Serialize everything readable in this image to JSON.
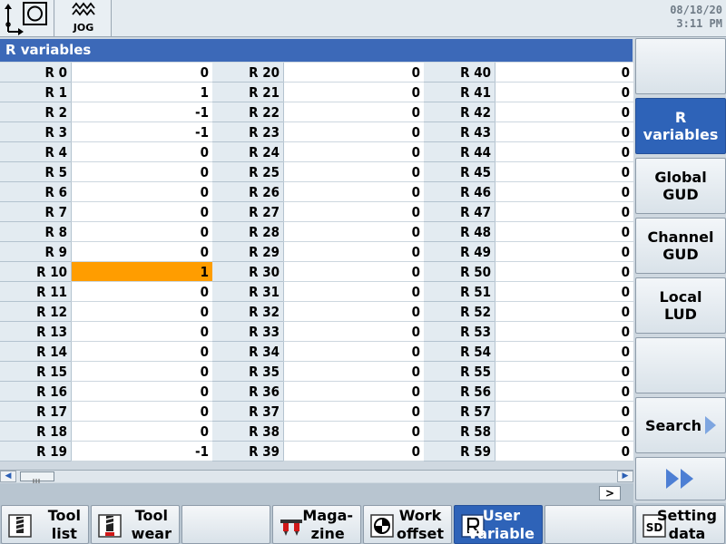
{
  "header": {
    "mode_label": "JOG",
    "date": "08/18/20",
    "time": "3:11 PM",
    "icons": [
      "machine-area-icon",
      "jog-mode-icon"
    ]
  },
  "window": {
    "title": "R variables"
  },
  "table": {
    "columns": [
      [
        {
          "name": "R 0",
          "value": "0"
        },
        {
          "name": "R 1",
          "value": "1"
        },
        {
          "name": "R 2",
          "value": "-1"
        },
        {
          "name": "R 3",
          "value": "-1"
        },
        {
          "name": "R 4",
          "value": "0"
        },
        {
          "name": "R 5",
          "value": "0"
        },
        {
          "name": "R 6",
          "value": "0"
        },
        {
          "name": "R 7",
          "value": "0"
        },
        {
          "name": "R 8",
          "value": "0"
        },
        {
          "name": "R 9",
          "value": "0"
        },
        {
          "name": "R 10",
          "value": "1"
        },
        {
          "name": "R 11",
          "value": "0"
        },
        {
          "name": "R 12",
          "value": "0"
        },
        {
          "name": "R 13",
          "value": "0"
        },
        {
          "name": "R 14",
          "value": "0"
        },
        {
          "name": "R 15",
          "value": "0"
        },
        {
          "name": "R 16",
          "value": "0"
        },
        {
          "name": "R 17",
          "value": "0"
        },
        {
          "name": "R 18",
          "value": "0"
        },
        {
          "name": "R 19",
          "value": "-1"
        }
      ],
      [
        {
          "name": "R 20",
          "value": "0"
        },
        {
          "name": "R 21",
          "value": "0"
        },
        {
          "name": "R 22",
          "value": "0"
        },
        {
          "name": "R 23",
          "value": "0"
        },
        {
          "name": "R 24",
          "value": "0"
        },
        {
          "name": "R 25",
          "value": "0"
        },
        {
          "name": "R 26",
          "value": "0"
        },
        {
          "name": "R 27",
          "value": "0"
        },
        {
          "name": "R 28",
          "value": "0"
        },
        {
          "name": "R 29",
          "value": "0"
        },
        {
          "name": "R 30",
          "value": "0"
        },
        {
          "name": "R 31",
          "value": "0"
        },
        {
          "name": "R 32",
          "value": "0"
        },
        {
          "name": "R 33",
          "value": "0"
        },
        {
          "name": "R 34",
          "value": "0"
        },
        {
          "name": "R 35",
          "value": "0"
        },
        {
          "name": "R 36",
          "value": "0"
        },
        {
          "name": "R 37",
          "value": "0"
        },
        {
          "name": "R 38",
          "value": "0"
        },
        {
          "name": "R 39",
          "value": "0"
        }
      ],
      [
        {
          "name": "R 40",
          "value": "0"
        },
        {
          "name": "R 41",
          "value": "0"
        },
        {
          "name": "R 42",
          "value": "0"
        },
        {
          "name": "R 43",
          "value": "0"
        },
        {
          "name": "R 44",
          "value": "0"
        },
        {
          "name": "R 45",
          "value": "0"
        },
        {
          "name": "R 46",
          "value": "0"
        },
        {
          "name": "R 47",
          "value": "0"
        },
        {
          "name": "R 48",
          "value": "0"
        },
        {
          "name": "R 49",
          "value": "0"
        },
        {
          "name": "R 50",
          "value": "0"
        },
        {
          "name": "R 51",
          "value": "0"
        },
        {
          "name": "R 52",
          "value": "0"
        },
        {
          "name": "R 53",
          "value": "0"
        },
        {
          "name": "R 54",
          "value": "0"
        },
        {
          "name": "R 55",
          "value": "0"
        },
        {
          "name": "R 56",
          "value": "0"
        },
        {
          "name": "R 57",
          "value": "0"
        },
        {
          "name": "R 58",
          "value": "0"
        },
        {
          "name": "R 59",
          "value": "0"
        }
      ]
    ],
    "selected": {
      "column": 0,
      "row": 10
    },
    "selected_color": "#ff9d00"
  },
  "status": {
    "more_label": ">"
  },
  "vertical_softkeys": [
    {
      "label": "",
      "active": false
    },
    {
      "label": "R\nvariables",
      "active": true
    },
    {
      "label": "Global\nGUD",
      "active": false
    },
    {
      "label": "Channel\nGUD",
      "active": false
    },
    {
      "label": "Local\nLUD",
      "active": false
    },
    {
      "label": "",
      "active": false
    },
    {
      "label": "Search",
      "active": false,
      "icon": "arrow-right-icon"
    },
    {
      "label": "",
      "active": false,
      "icon": "double-arrow-right-icon"
    }
  ],
  "horizontal_softkeys": [
    {
      "label": "Tool\nlist",
      "icon": "tool-list-icon",
      "active": false
    },
    {
      "label": "Tool\nwear",
      "icon": "tool-wear-icon",
      "active": false
    },
    {
      "label": "",
      "icon": "",
      "active": false
    },
    {
      "label": "Maga-\nzine",
      "icon": "magazine-icon",
      "active": false
    },
    {
      "label": "Work\noffset",
      "icon": "work-offset-icon",
      "active": false
    },
    {
      "label": "User\nvariable",
      "icon": "user-variable-icon",
      "active": true
    },
    {
      "label": "",
      "icon": "",
      "active": false
    },
    {
      "label": "Setting\ndata",
      "icon": "setting-data-icon",
      "active": false
    }
  ],
  "colors": {
    "title_bar": "#3c69b8",
    "active_softkey": "#2e63b8",
    "name_cell_bg": "#e3ebf1"
  }
}
